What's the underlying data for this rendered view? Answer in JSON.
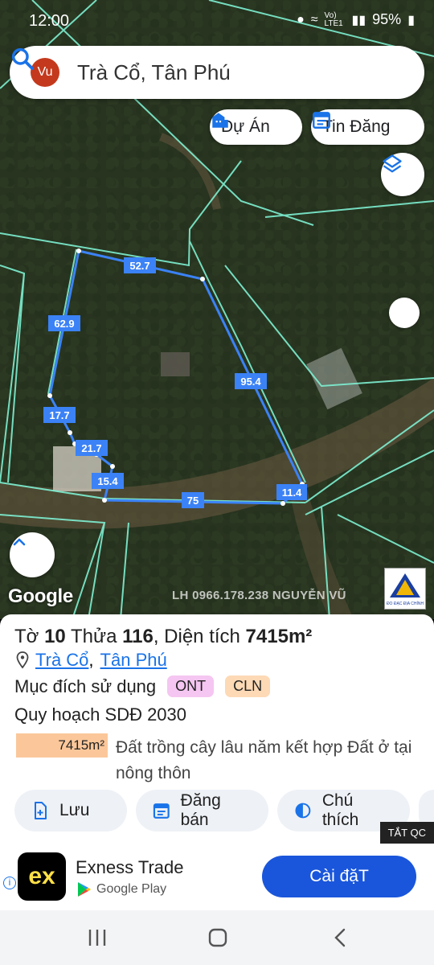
{
  "status_bar": {
    "time": "12:00",
    "battery": "95%",
    "volte": "Vo) LTE1"
  },
  "search": {
    "avatar": "Vu",
    "query": "Trà Cổ, Tân Phú"
  },
  "map": {
    "chips": [
      {
        "label": "Dự Án",
        "icon": "building-icon"
      },
      {
        "label": "Tin Đăng",
        "icon": "calendar-icon"
      }
    ],
    "layers_icon": "layers-icon",
    "collapse_icon": "chevron-up-icon",
    "google_label": "Google",
    "watermark": "LH 0966.178.238 NGUYỄN VŨ",
    "watermark_logo_text": "ĐO ĐẠC ĐỊA CHÍNH",
    "edge_labels": {
      "top": "52.7",
      "left": "62.9",
      "right": "95.4",
      "left_lower": "17.7",
      "step_a": "21.7",
      "step_b": "15.4",
      "bottom": "75",
      "bottom_right": "11.4"
    },
    "boundary_color": "#3b82f6",
    "parcel_line_color": "#7ef0d2"
  },
  "parcel": {
    "to_label": "Tờ",
    "to_value": "10",
    "thua_label": "Thửa",
    "thua_value": "116",
    "area_label": ", Diện tích",
    "area_value": "7415m²",
    "commune": "Trà Cổ",
    "district": "Tân Phú",
    "purpose_label": "Mục đích sử dụng",
    "purpose_tags": [
      "ONT",
      "CLN"
    ],
    "plan_label": "Quy hoạch SDĐ 2030",
    "plan_area": "7415m²",
    "plan_description": "Đất trồng cây lâu năm kết hợp Đất ở tại nông thôn"
  },
  "actions": [
    {
      "label": "Lưu",
      "icon": "file-add-icon"
    },
    {
      "label": "Đăng bán",
      "icon": "calendar-icon"
    },
    {
      "label": "Chú thích",
      "icon": "half-circle-icon"
    }
  ],
  "ad": {
    "hide_label": "TẮT QC",
    "app_icon_text": "ex",
    "title": "Exness Trade",
    "store": "Google Play",
    "install_label": "Cài đặT"
  }
}
